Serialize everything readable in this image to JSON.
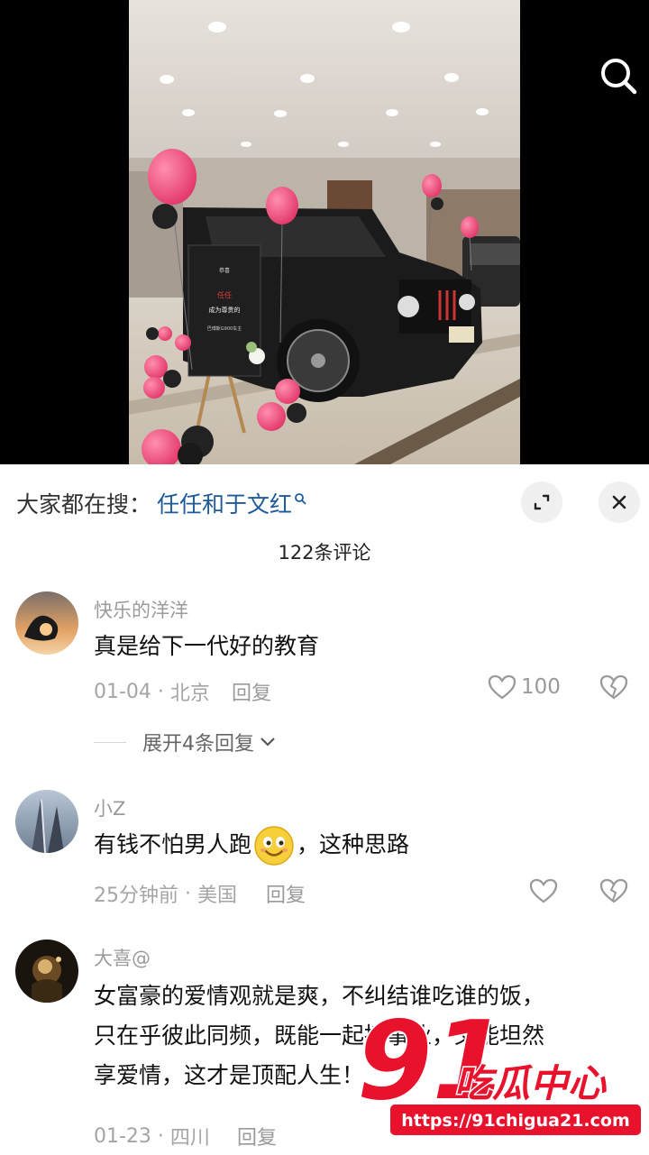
{
  "video": {
    "placard_heading": "恭喜",
    "placard_name": "任任",
    "placard_line1": "成为尊贵的",
    "placard_line2": "巴博斯G900车主"
  },
  "hot_search": {
    "prefix": "大家都在搜：",
    "query": "任任和于文红"
  },
  "comment_count": "122条评论",
  "comments": [
    {
      "user": "快乐的洋洋",
      "text": "真是给下一代好的教育",
      "time": "01-04",
      "location": "北京",
      "reply_label": "回复",
      "likes": "100",
      "expand_label": "展开4条回复"
    },
    {
      "user": "小Z",
      "text_before": "有钱不怕男人跑",
      "emoji": "grinning-emoji",
      "text_after": "，这种思路",
      "time": "25分钟前",
      "location": "美国",
      "reply_label": "回复"
    },
    {
      "user": "大喜@",
      "lines": [
        "女富豪的爱情观就是爽，不纠结谁吃谁的饭，",
        "只在乎彼此同频，既能一起搞事业，又能坦然",
        "享爱情，这才是顶配人生！"
      ],
      "time": "01-23",
      "location": "四川",
      "reply_label": "回复"
    }
  ],
  "watermark": {
    "number": "91",
    "name": "吃瓜中心",
    "url": "https://91chigua21.com"
  },
  "colors": {
    "link": "#1e5a9a",
    "brand_red": "#e8122d",
    "balloon_pink": "#f0507a"
  }
}
